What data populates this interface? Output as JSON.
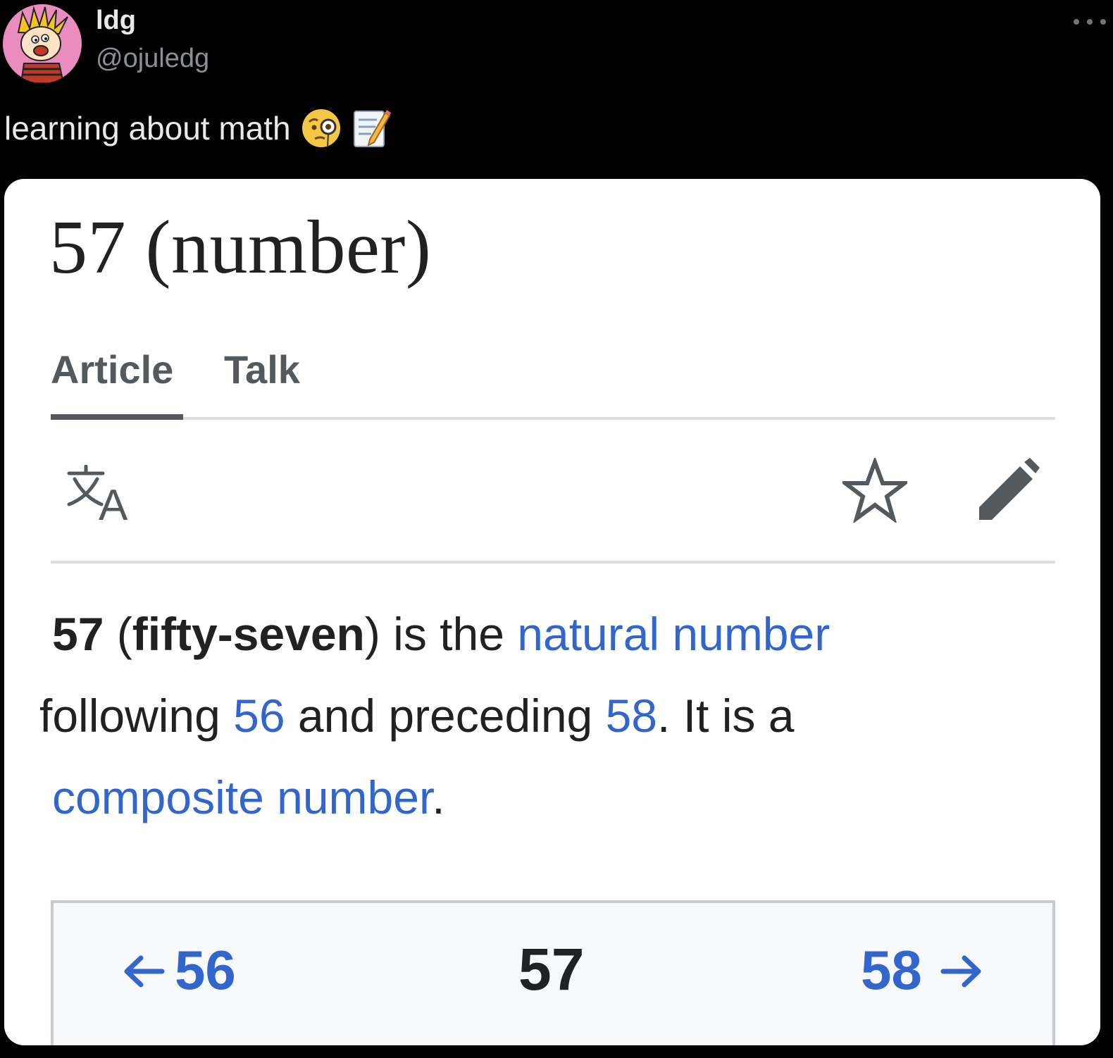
{
  "tweet": {
    "display_name": "ldg",
    "handle": "@ojuledg",
    "text": "learning about math",
    "emojis": [
      "face-with-monocle",
      "memo"
    ]
  },
  "article": {
    "title": "57 (number)",
    "tabs": [
      {
        "label": "Article",
        "active": true
      },
      {
        "label": "Talk",
        "active": false
      }
    ],
    "toolbar_icons": [
      "language-icon",
      "star-icon",
      "pencil-icon"
    ],
    "lead": {
      "number": "57",
      "paren_open": " (",
      "name": "fifty-seven",
      "paren_close": ")",
      "text1": " is the ",
      "link1": "natural number",
      "text2": " following ",
      "link2": "56",
      "text3": " and preceding ",
      "link3": "58",
      "text4": ". It is a ",
      "link4": "composite number",
      "text5": "."
    },
    "navigation": {
      "prev": "56",
      "current": "57",
      "next": "58"
    }
  },
  "colors": {
    "background": "#000000",
    "link": "#3366cc",
    "text": "#202122",
    "tab_gray": "#54595d"
  }
}
